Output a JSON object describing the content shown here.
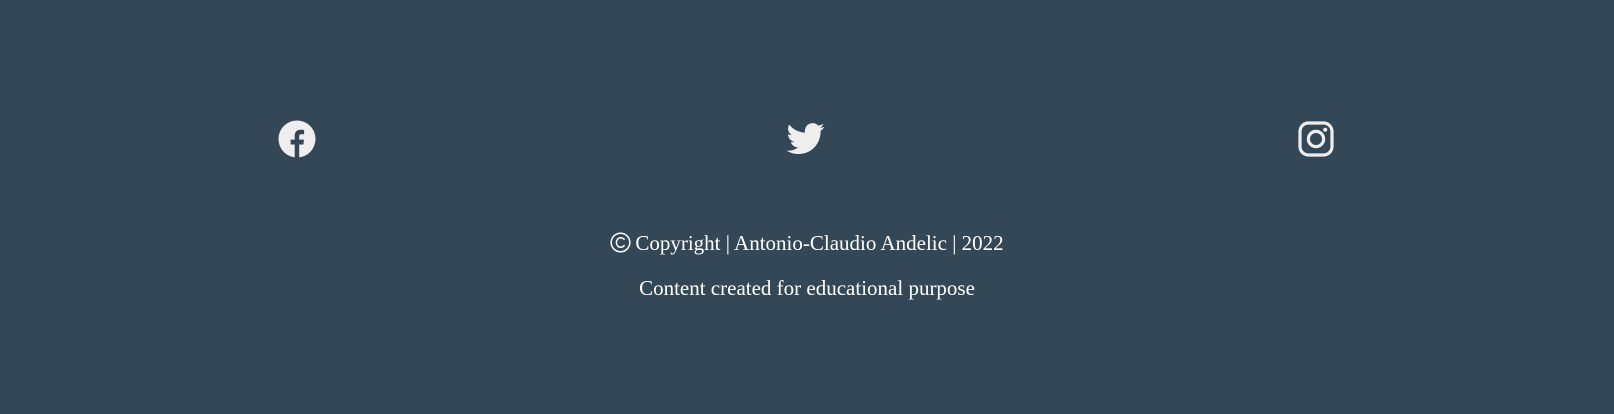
{
  "footer": {
    "background_color": "#344756",
    "icon_color": "#eeeeee",
    "text_color": "#ffffff",
    "social": [
      {
        "name": "facebook",
        "icon": "facebook-icon"
      },
      {
        "name": "twitter",
        "icon": "twitter-icon"
      },
      {
        "name": "instagram",
        "icon": "instagram-icon"
      }
    ],
    "copyright_symbol_icon": "copyright-icon",
    "copyright_text": "Copyright | Antonio-Claudio Andelic | 2022",
    "purpose_text": "Content created for educational purpose"
  }
}
